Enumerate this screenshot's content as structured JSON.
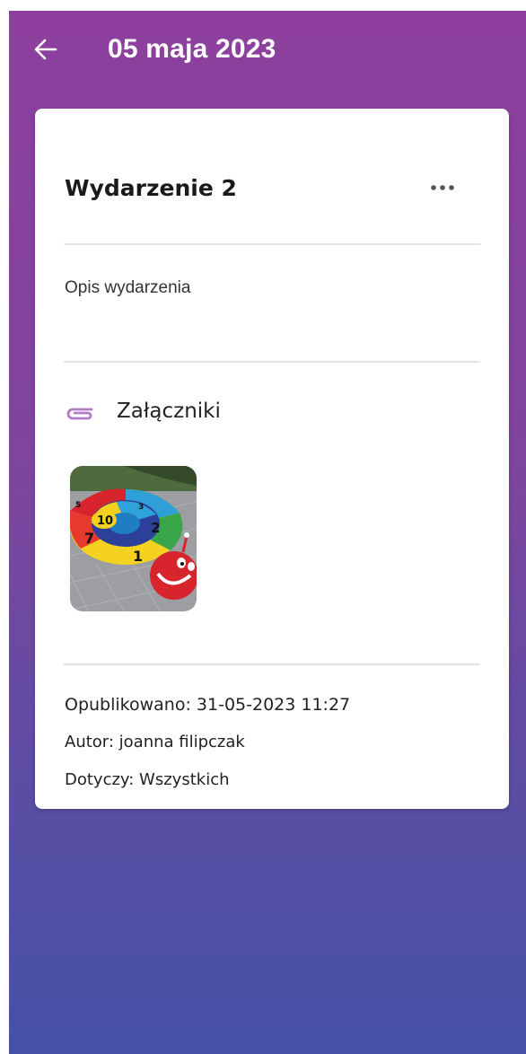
{
  "header": {
    "title": "05 maja 2023",
    "back_icon": "arrow-left-icon"
  },
  "event": {
    "title": "Wydarzenie 2",
    "more_icon": "more-horizontal-icon",
    "description": "Opis wydarzenia",
    "attachments_label": "Załączniki",
    "attachments_icon": "paperclip-icon",
    "attachment_thumbnail": "snail-hopscotch-image",
    "published": "Opublikowano: 31-05-2023 11:27",
    "author": "Autor: joanna filipczak",
    "concerns": "Dotyczy: Wszystkich"
  },
  "colors": {
    "gradient_top": "#8e3f9d",
    "gradient_bottom": "#4551a5",
    "accent": "#b07cc6",
    "card": "#ffffff"
  }
}
